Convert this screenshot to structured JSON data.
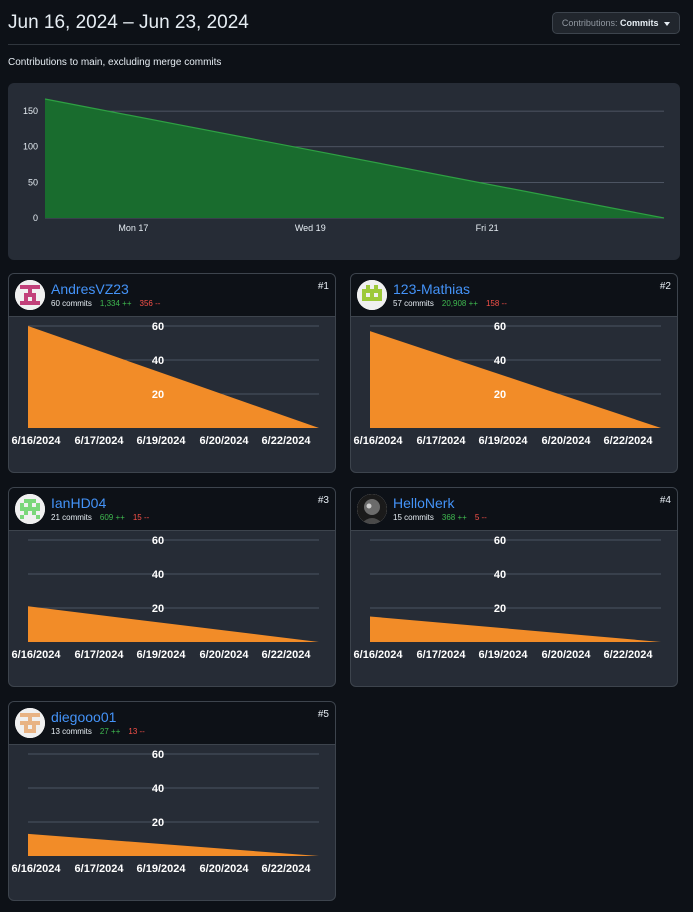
{
  "header": {
    "title": "Jun 16, 2024 – Jun 23, 2024",
    "dropdown_prefix": "Contributions:",
    "dropdown_value": "Commits"
  },
  "subtitle": "Contributions to main, excluding merge commits",
  "colors": {
    "overview_fill": "#196c2e",
    "overview_stroke": "#2ea043",
    "user_fill": "#f28c28",
    "link": "#4493f8",
    "additions": "#3fb950",
    "deletions": "#f85149"
  },
  "chart_data": [
    {
      "id": "overview",
      "type": "area",
      "x_ticks": [
        "Mon 17",
        "Wed 19",
        "Fri 21"
      ],
      "x_tick_days": [
        1,
        3,
        5
      ],
      "x": [
        0,
        7
      ],
      "y": [
        167,
        0
      ],
      "y_ticks": [
        0,
        50,
        100,
        150
      ],
      "ylim": [
        0,
        167
      ]
    },
    {
      "id": "user-1",
      "type": "area",
      "x_ticks": [
        "6/16/2024",
        "6/17/2024",
        "6/19/2024",
        "6/20/2024",
        "6/22/2024"
      ],
      "y": [
        60,
        0
      ],
      "y_ticks": [
        20,
        40,
        60
      ],
      "ylim": [
        0,
        60
      ]
    },
    {
      "id": "user-2",
      "type": "area",
      "x_ticks": [
        "6/16/2024",
        "6/17/2024",
        "6/19/2024",
        "6/20/2024",
        "6/22/2024"
      ],
      "y": [
        57,
        0
      ],
      "y_ticks": [
        20,
        40,
        60
      ],
      "ylim": [
        0,
        60
      ]
    },
    {
      "id": "user-3",
      "type": "area",
      "x_ticks": [
        "6/16/2024",
        "6/17/2024",
        "6/19/2024",
        "6/20/2024",
        "6/22/2024"
      ],
      "y": [
        21,
        0
      ],
      "y_ticks": [
        20,
        40,
        60
      ],
      "ylim": [
        0,
        60
      ]
    },
    {
      "id": "user-4",
      "type": "area",
      "x_ticks": [
        "6/16/2024",
        "6/17/2024",
        "6/19/2024",
        "6/20/2024",
        "6/22/2024"
      ],
      "y": [
        15,
        0
      ],
      "y_ticks": [
        20,
        40,
        60
      ],
      "ylim": [
        0,
        60
      ]
    },
    {
      "id": "user-5",
      "type": "area",
      "x_ticks": [
        "6/16/2024",
        "6/17/2024",
        "6/19/2024",
        "6/20/2024",
        "6/22/2024"
      ],
      "y": [
        13,
        0
      ],
      "y_ticks": [
        20,
        40,
        60
      ],
      "ylim": [
        0,
        60
      ]
    }
  ],
  "contributors": [
    {
      "rank": "#1",
      "name": "AndresVZ23",
      "commits": "60 commits",
      "additions": "1,334 ++",
      "deletions": "356 --",
      "avatar_icon": "identicon-pink",
      "avatar_color": "#c2407a"
    },
    {
      "rank": "#2",
      "name": "123-Mathias",
      "commits": "57 commits",
      "additions": "20,908 ++",
      "deletions": "158 --",
      "avatar_icon": "identicon-olive",
      "avatar_color": "#9dc93a"
    },
    {
      "rank": "#3",
      "name": "IanHD04",
      "commits": "21 commits",
      "additions": "609 ++",
      "deletions": "15 --",
      "avatar_icon": "identicon-green",
      "avatar_color": "#7ad77a"
    },
    {
      "rank": "#4",
      "name": "HelloNerk",
      "commits": "15 commits",
      "additions": "368 ++",
      "deletions": "5 --",
      "avatar_icon": "photo-avatar",
      "avatar_color": "#444444"
    },
    {
      "rank": "#5",
      "name": "diegooo01",
      "commits": "13 commits",
      "additions": "27 ++",
      "deletions": "13 --",
      "avatar_icon": "identicon-peach",
      "avatar_color": "#e8b384"
    }
  ]
}
